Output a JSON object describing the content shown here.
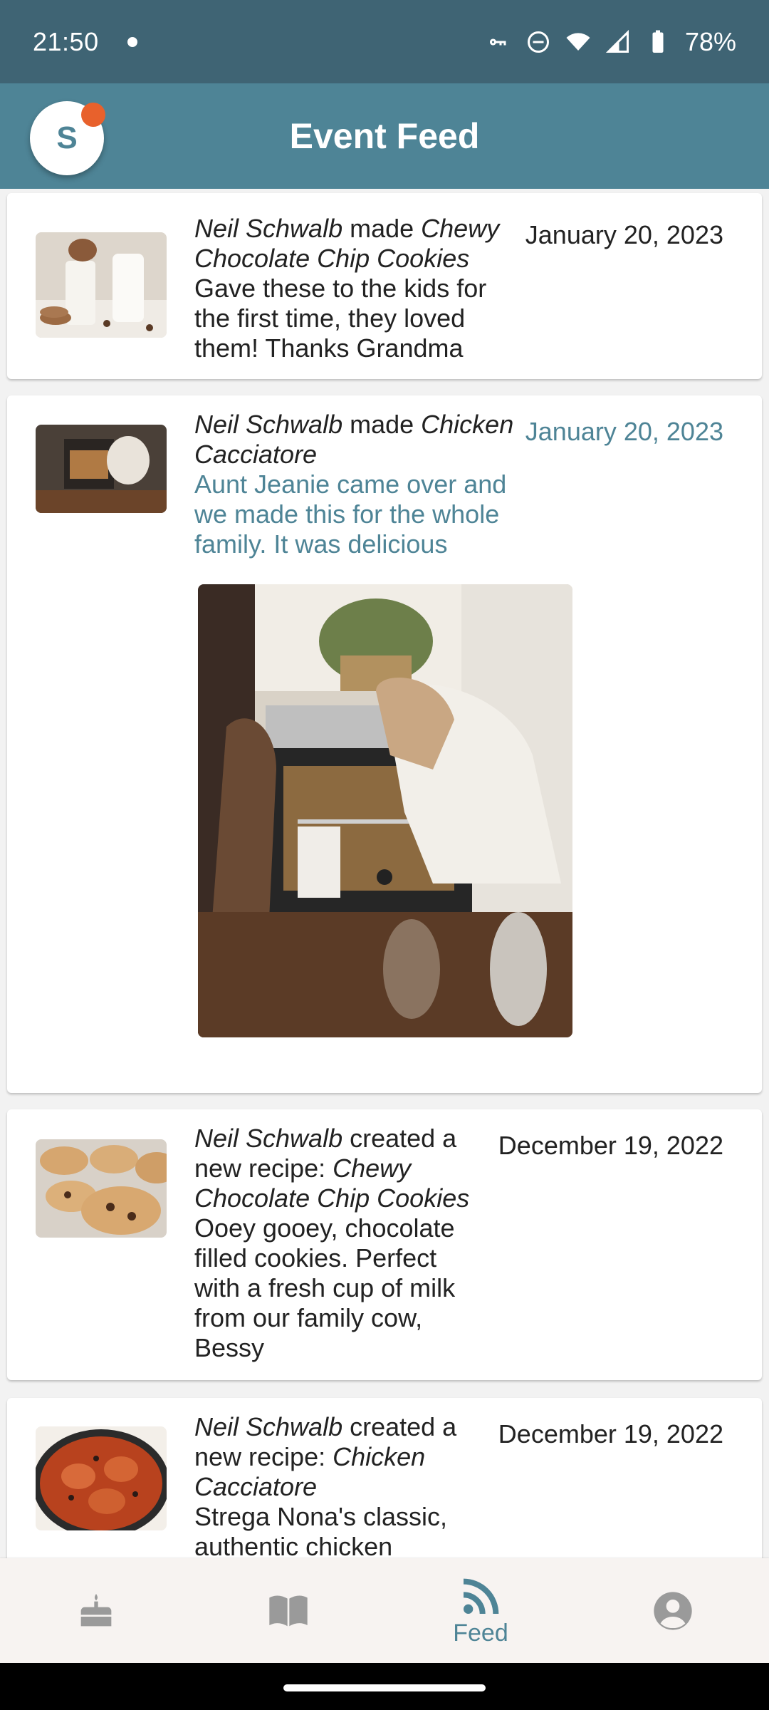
{
  "status_bar": {
    "time": "21:50",
    "battery": "78%",
    "icons": [
      "notification-dot-icon",
      "vpn-key-icon",
      "do-not-disturb-icon",
      "wifi-icon",
      "cell-signal-icon",
      "battery-icon"
    ]
  },
  "app_bar": {
    "title": "Event Feed",
    "avatar_letter": "S",
    "accent_color": "#4e8496",
    "badge_color": "#e8612c"
  },
  "feed": [
    {
      "user": "Neil Schwalb",
      "action": " made ",
      "recipe": "Chewy Chocolate Chip Cookies",
      "caption": "Gave these to the kids for the first time, they loved them! Thanks Grandma",
      "date": "January 20, 2023"
    },
    {
      "user": "Neil Schwalb",
      "action": " made ",
      "recipe": "Chicken Cacciatore",
      "caption": "Aunt Jeanie came over and we made this for the whole family. It was delicious",
      "date": "January 20, 2023"
    },
    {
      "user": "Neil Schwalb",
      "action": " created a new recipe: ",
      "recipe": "Chewy Chocolate Chip Cookies",
      "caption": "Ooey gooey, chocolate filled cookies. Perfect with a fresh cup of milk from our family cow, Bessy",
      "date": "December 19, 2022"
    },
    {
      "user": "Neil Schwalb",
      "action": " created a new recipe: ",
      "recipe": "Chicken Cacciatore",
      "caption": "Strega Nona's classic, authentic chicken",
      "date": "December 19, 2022"
    }
  ],
  "bottom_nav": {
    "items": [
      {
        "icon": "cake-icon",
        "label": ""
      },
      {
        "icon": "recipe-book-icon",
        "label": ""
      },
      {
        "icon": "feed-icon",
        "label": "Feed"
      },
      {
        "icon": "account-icon",
        "label": ""
      }
    ]
  }
}
